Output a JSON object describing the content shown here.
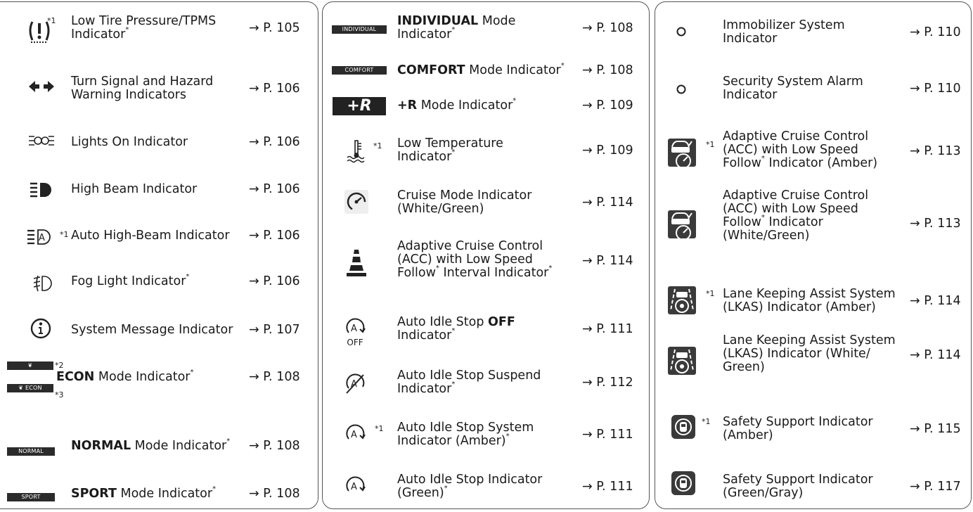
{
  "page_ref_prefix": "→ P. ",
  "col1": [
    {
      "icon": "tpms-icon",
      "text": "Low Tire Pressure/TPMS Indicator",
      "star": true,
      "fn": "*1",
      "page": "105"
    },
    {
      "icon": "turn-signal-icon",
      "text": "Turn Signal and Hazard Warning Indicators",
      "page": "106"
    },
    {
      "icon": "lights-on-icon",
      "text": "Lights On Indicator",
      "page": "106"
    },
    {
      "icon": "high-beam-icon",
      "text": "High Beam Indicator",
      "page": "106"
    },
    {
      "icon": "auto-high-beam-icon",
      "text": "Auto High-Beam Indicator",
      "fn": "*1",
      "page": "106"
    },
    {
      "icon": "fog-light-icon",
      "text": "Fog Light Indicator",
      "star": true,
      "page": "106"
    },
    {
      "icon": "info-icon",
      "text": "System Message Indicator",
      "page": "107"
    },
    {
      "icon": "econ-icon",
      "bold": "ECON",
      "text": " Mode Indicator",
      "star": true,
      "page": "108",
      "fn2": "*2",
      "fn3": "*3",
      "tag": "ECON"
    },
    {
      "icon": "normal-mode-icon",
      "bold": "NORMAL",
      "text": " Mode Indicator",
      "star": true,
      "page": "108",
      "tag": "NORMAL"
    },
    {
      "icon": "sport-mode-icon",
      "bold": "SPORT",
      "text": " Mode Indicator",
      "star": true,
      "page": "108",
      "tag": "SPORT"
    }
  ],
  "col2": [
    {
      "icon": "individual-mode-icon",
      "bold": "INDIVIDUAL",
      "text": " Mode Indicator",
      "star": true,
      "page": "108",
      "tag": "INDIVIDUAL"
    },
    {
      "icon": "comfort-mode-icon",
      "bold": "COMFORT",
      "text": " Mode Indicator",
      "star": true,
      "page": "108",
      "tag": "COMFORT"
    },
    {
      "icon": "r-mode-icon",
      "bold": "+R",
      "text": " Mode Indicator",
      "star": true,
      "page": "109",
      "glyph": "+R"
    },
    {
      "icon": "low-temperature-icon",
      "text": "Low Temperature Indicator",
      "star": true,
      "fn": "*1",
      "page": "109"
    },
    {
      "icon": "cruise-mode-icon",
      "text": "Cruise Mode Indicator (White/Green)",
      "page": "114"
    },
    {
      "icon": "acc-interval-icon",
      "text": "Adaptive Cruise Control (ACC) with Low Speed Follow",
      "text2": " Interval Indicator",
      "star": true,
      "page": "114"
    },
    {
      "icon": "auto-idle-stop-off-icon",
      "text": "Auto Idle Stop ",
      "bold": "OFF",
      "text2": " Indicator",
      "star": true,
      "page": "111",
      "sub": "OFF"
    },
    {
      "icon": "auto-idle-stop-suspend-icon",
      "text": "Auto Idle Stop Suspend Indicator",
      "star": true,
      "page": "112"
    },
    {
      "icon": "auto-idle-stop-system-icon",
      "text": "Auto Idle Stop System Indicator (Amber)",
      "star": true,
      "fn": "*1",
      "page": "111"
    },
    {
      "icon": "auto-idle-stop-green-icon",
      "text": "Auto Idle Stop Indicator (Green)",
      "star": true,
      "page": "111"
    }
  ],
  "col3": [
    {
      "icon": "immobilizer-icon",
      "text": "Immobilizer System Indicator",
      "page": "110"
    },
    {
      "icon": "security-alarm-icon",
      "text": "Security System Alarm Indicator",
      "page": "110"
    },
    {
      "icon": "acc-amber-icon",
      "text": "Adaptive Cruise Control (ACC) with Low Speed Follow",
      "text2": " Indicator (Amber)",
      "fn": "*1",
      "page": "113"
    },
    {
      "icon": "acc-white-green-icon",
      "text": "Adaptive Cruise Control (ACC) with Low Speed Follow",
      "text2": " Indicator (White/Green)",
      "page": "113"
    },
    {
      "icon": "lkas-amber-icon",
      "text": "Lane Keeping Assist System (LKAS) Indicator (Amber)",
      "fn": "*1",
      "page": "114"
    },
    {
      "icon": "lkas-white-green-icon",
      "text": "Lane Keeping Assist System (LKAS) Indicator (White/ Green)",
      "page": "114"
    },
    {
      "icon": "safety-support-amber-icon",
      "text": "Safety Support Indicator (Amber)",
      "fn": "*1",
      "page": "115"
    },
    {
      "icon": "safety-support-green-icon",
      "text": "Safety Support Indicator (Green/Gray)",
      "page": "117"
    }
  ]
}
